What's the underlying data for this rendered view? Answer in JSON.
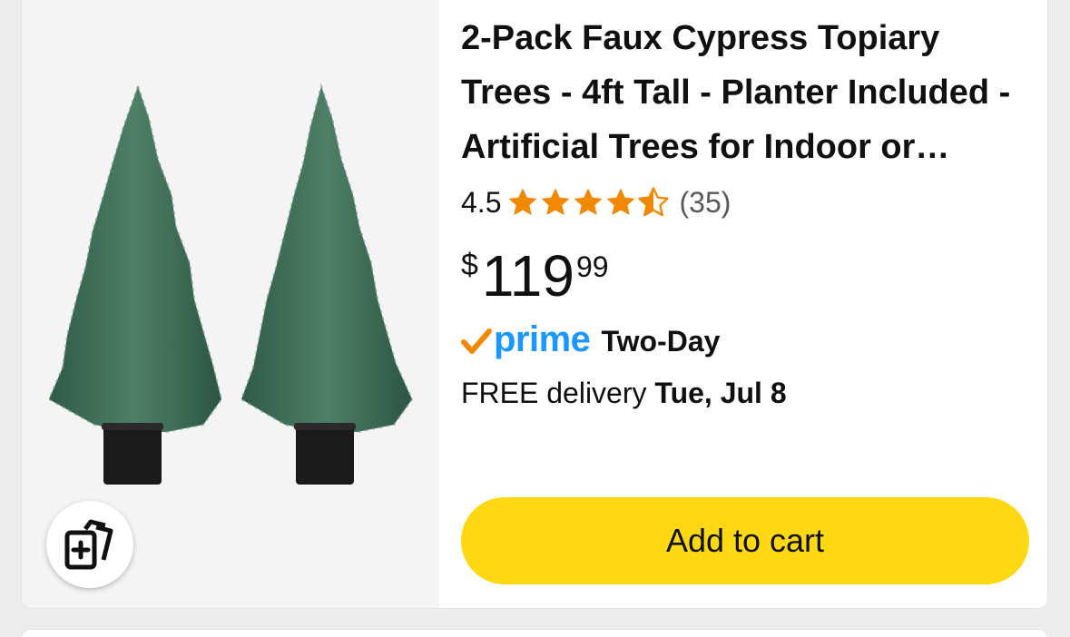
{
  "product": {
    "title": "2-Pack Faux Cypress Topiary Trees - 4ft Tall - Planter Included - Artificial Trees for Indoor or Outdoor Use",
    "rating_value": "4.5",
    "rating_stars": 4.5,
    "rating_max": 5,
    "review_count": "(35)",
    "price_symbol": "$",
    "price_whole": "119",
    "price_fraction": "99",
    "prime_label": "prime",
    "prime_speed": "Two-Day",
    "delivery_prefix": "FREE delivery ",
    "delivery_date": "Tue, Jul 8",
    "add_to_cart_label": "Add to cart"
  },
  "icons": {
    "compare": "compare-icon",
    "prime_check": "prime-check-icon",
    "star": "star-icon"
  },
  "colors": {
    "star": "#f08804",
    "prime_blue": "#1a98ff",
    "prime_check": "#f08804",
    "add_to_cart_bg": "#ffd814",
    "text": "#0f1111",
    "secondary_text": "#565959",
    "image_bg": "#f4f4f4",
    "tree_green": "#3d6b56",
    "planter": "#1a1a1a"
  }
}
